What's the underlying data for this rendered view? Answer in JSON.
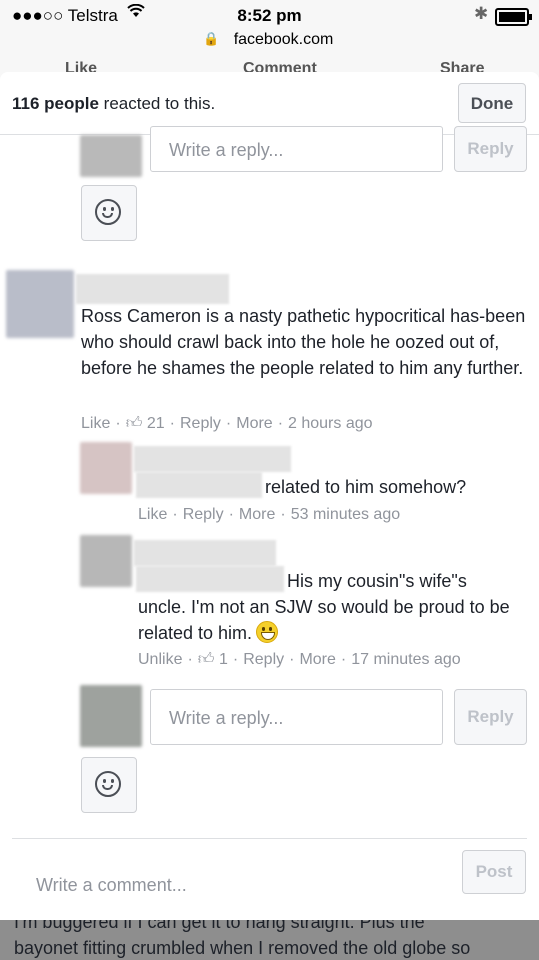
{
  "status_bar": {
    "carrier": "●●●○○ Telstra",
    "time": "8:52 pm",
    "url": "facebook.com"
  },
  "background_actions": [
    "Like",
    "Comment",
    "Share"
  ],
  "header": {
    "reaction_count": "116 people",
    "reaction_suffix": " reacted to this.",
    "done_label": "Done"
  },
  "reply_box": {
    "placeholder": "Write a reply...",
    "button": "Reply"
  },
  "comments": [
    {
      "text": "Ross Cameron is a nasty pathetic hypocritical has-been who should crawl back into the hole he oozed out of, before he shames the people related to him any further.",
      "like": "Like",
      "likes": "21",
      "reply": "Reply",
      "more": "More",
      "time": "2 hours ago"
    },
    {
      "text": "related to him somehow?",
      "like": "Like",
      "reply": "Reply",
      "more": "More",
      "time": "53 minutes ago"
    },
    {
      "text_line1": "His my cousin\"s wife\"s",
      "text_rest": "uncle. I'm not an SJW so would be proud to be related to him.",
      "like": "Unlike",
      "likes": "1",
      "reply": "Reply",
      "more": "More",
      "time": "17 minutes ago"
    }
  ],
  "footer": {
    "placeholder": "Write a comment...",
    "button": "Post"
  },
  "background_text": {
    "line1": "I'm buggered if I can get it to hang straight. Plus the",
    "line2": "bayonet fitting crumbled when I removed the old globe so"
  },
  "icons": [
    "smiley-icon",
    "thumbs-up-icon",
    "wifi-icon",
    "bluetooth-icon",
    "battery-icon",
    "lock-icon"
  ]
}
